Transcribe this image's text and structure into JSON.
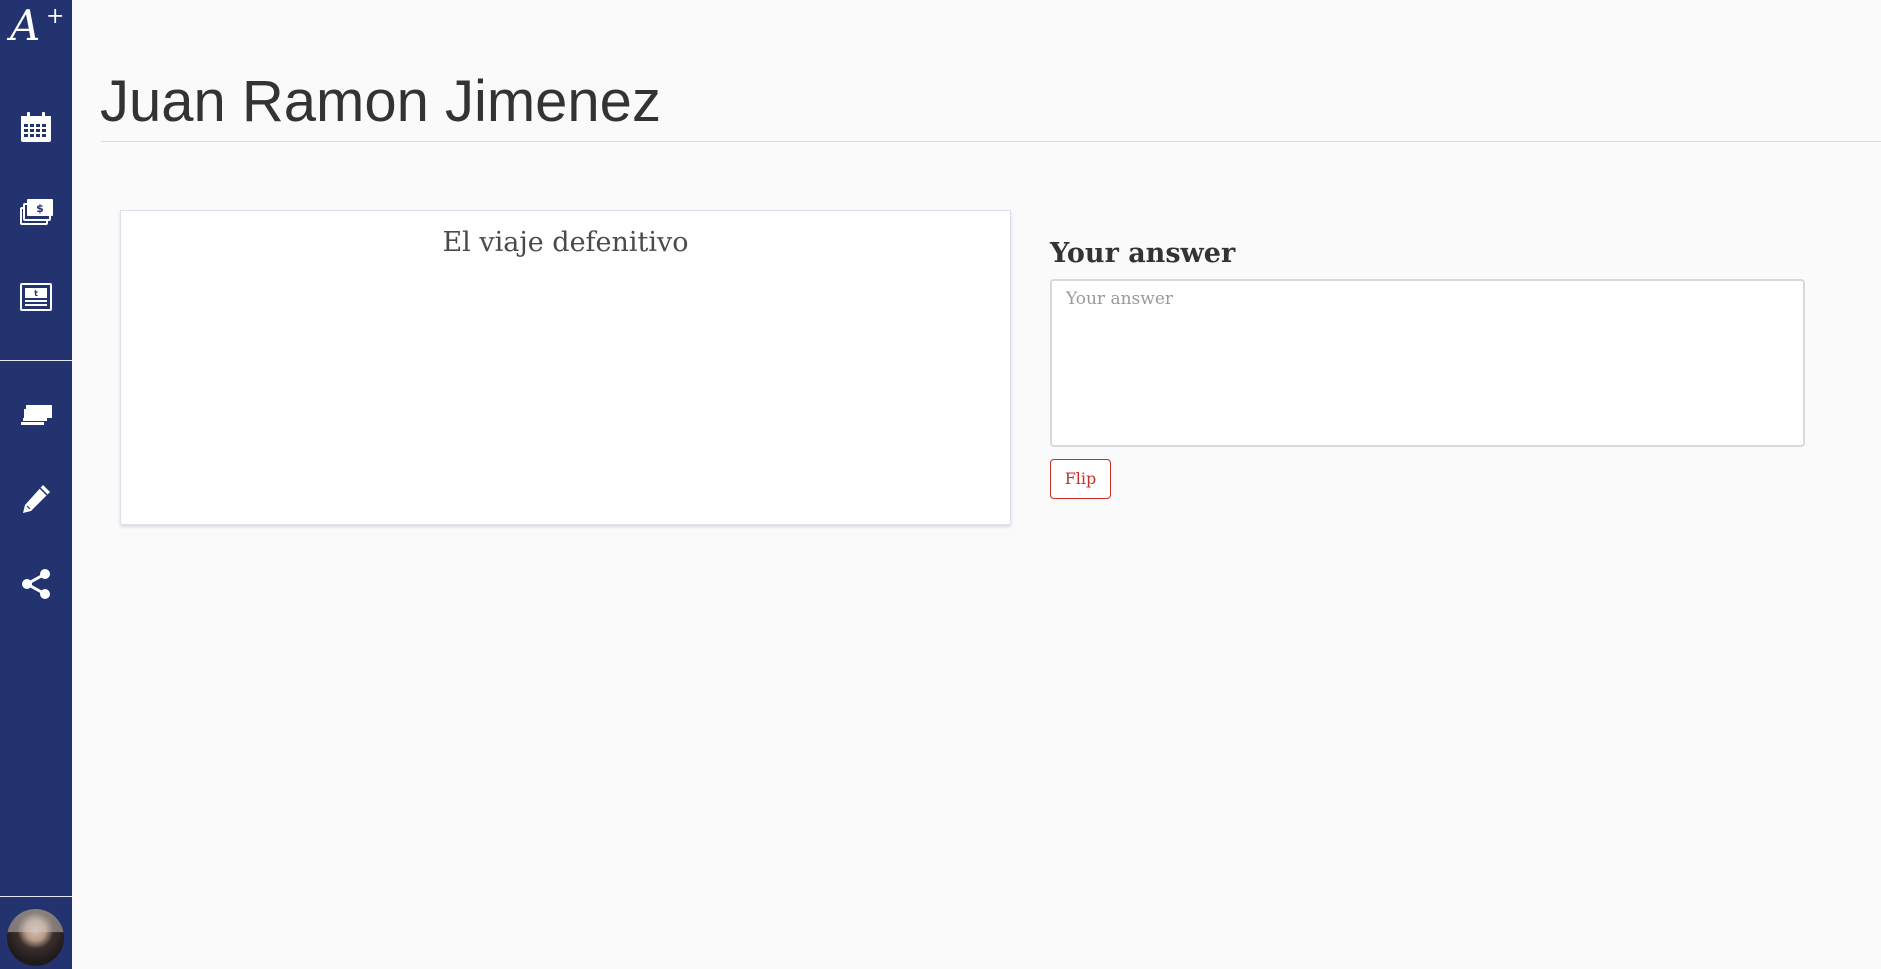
{
  "sidebar": {
    "logo_text": "A",
    "logo_plus": "+",
    "items": [
      {
        "name": "calendar",
        "icon": "calendar-icon"
      },
      {
        "name": "payments",
        "icon": "money-stack-icon"
      },
      {
        "name": "tuition",
        "icon": "monitor-card-icon"
      },
      {
        "name": "flashcards",
        "icon": "cards-stack-icon"
      },
      {
        "name": "edit",
        "icon": "pencil-icon"
      },
      {
        "name": "share",
        "icon": "share-icon"
      }
    ],
    "avatar": "user-avatar"
  },
  "page": {
    "title": "Juan Ramon Jimenez"
  },
  "flashcard": {
    "front_text": "El viaje defenitivo"
  },
  "answer": {
    "label": "Your answer",
    "placeholder": "Your answer",
    "value": ""
  },
  "actions": {
    "flip_label": "Flip"
  },
  "colors": {
    "sidebar": "#223370",
    "background": "#fafafa",
    "accent": "#c9302c"
  }
}
